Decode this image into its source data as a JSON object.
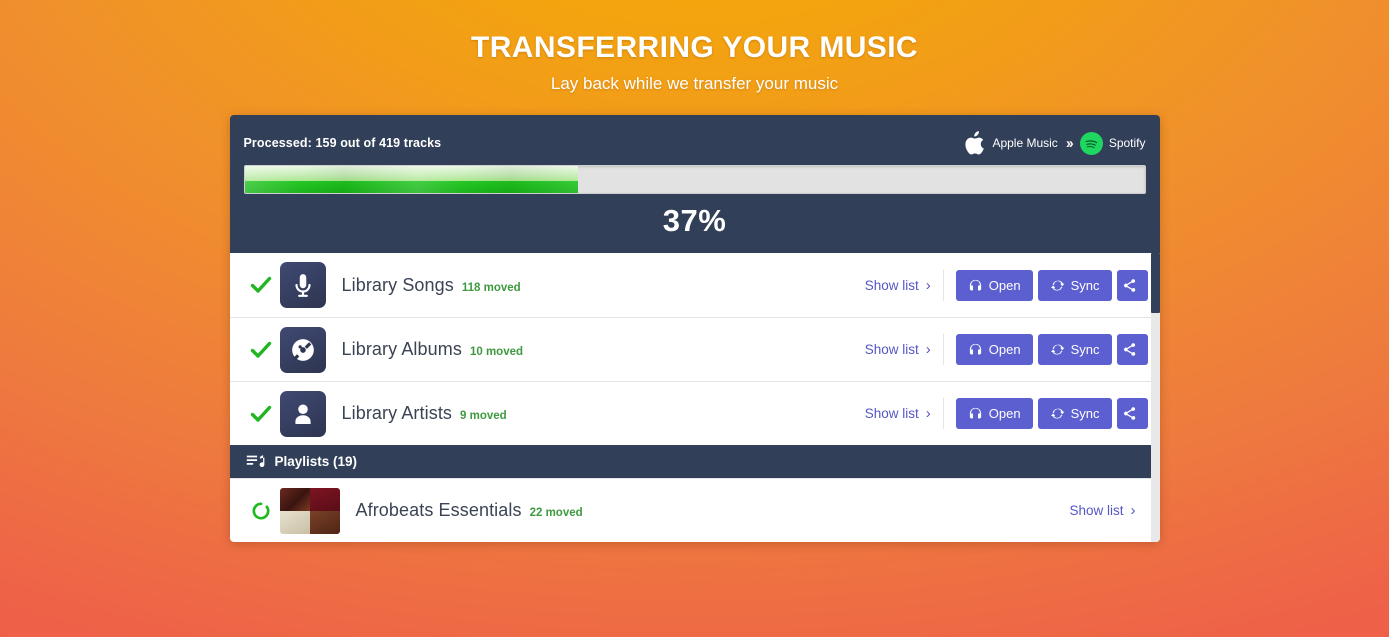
{
  "header": {
    "title": "TRANSFERRING YOUR MUSIC",
    "subtitle": "Lay back while we transfer your music"
  },
  "progress": {
    "processed_label": "Processed: 159 out of 419 tracks",
    "percent_label": "37%",
    "percent_value": 37,
    "processed_count": 159,
    "total_count": 419,
    "source": {
      "name": "Apple Music",
      "icon": "apple-icon"
    },
    "target": {
      "name": "Spotify",
      "icon": "spotify-icon"
    },
    "direction_icon": "double-chevron-right-icon",
    "colors": {
      "panel": "#323f58",
      "bar_track": "#e2e2e2",
      "bar_fill_top": "#cdf0bf",
      "bar_fill_bottom": "#19bb19"
    }
  },
  "library": {
    "rows": [
      {
        "name": "Library Songs",
        "moved": "118 moved",
        "status": "done",
        "icon": "microphone-icon",
        "show_list": "Show list",
        "open_label": "Open",
        "sync_label": "Sync",
        "share_label": ""
      },
      {
        "name": "Library Albums",
        "moved": "10 moved",
        "status": "done",
        "icon": "vinyl-disc-icon",
        "show_list": "Show list",
        "open_label": "Open",
        "sync_label": "Sync",
        "share_label": ""
      },
      {
        "name": "Library Artists",
        "moved": "9 moved",
        "status": "done",
        "icon": "person-icon",
        "show_list": "Show list",
        "open_label": "Open",
        "sync_label": "Sync",
        "share_label": ""
      }
    ]
  },
  "playlists": {
    "section_label": "Playlists (19)",
    "section_icon": "playlist-icon",
    "count": 19,
    "rows": [
      {
        "name": "Afrobeats Essentials",
        "moved": "22 moved",
        "status": "in-progress",
        "icon": "album-collage-thumbnail",
        "show_list": "Show list"
      }
    ]
  },
  "theme": {
    "accent_button": "#5b5fd0",
    "link": "#5558c4",
    "moved_green": "#3f9a3f",
    "check_green": "#22b522"
  }
}
